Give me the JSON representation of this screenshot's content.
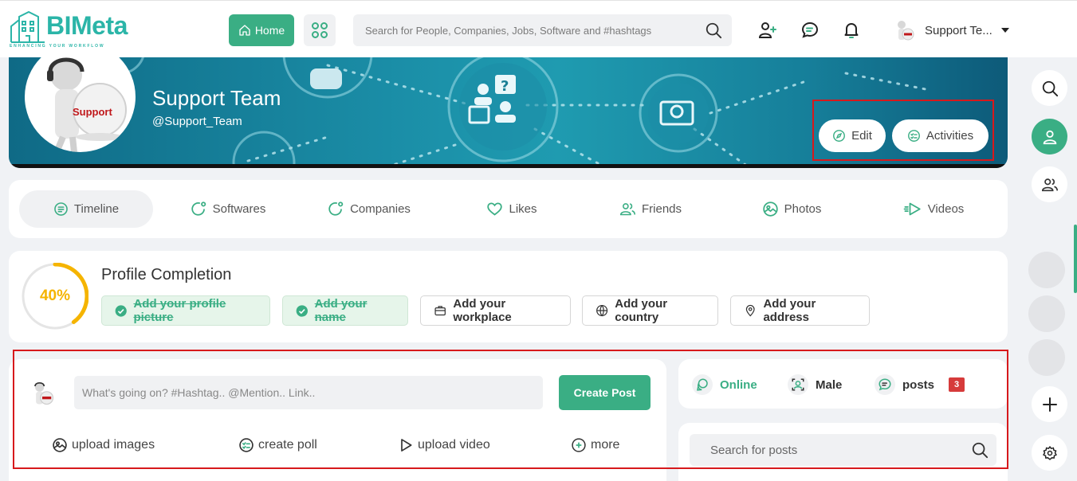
{
  "header": {
    "logo_text": "BIMeta",
    "logo_tagline": "ENHANCING YOUR WORKFLOW",
    "home_label": "Home",
    "search_placeholder": "Search for People, Companies, Jobs, Software and #hashtags",
    "user_name": "Support Te..."
  },
  "profile": {
    "name": "Support Team",
    "handle": "@Support_Team",
    "avatar_text": "Support",
    "edit_label": "Edit",
    "activities_label": "Activities"
  },
  "tabs": [
    {
      "label": "Timeline",
      "icon": "timeline-icon",
      "active": true
    },
    {
      "label": "Softwares",
      "icon": "softwares-icon"
    },
    {
      "label": "Companies",
      "icon": "companies-icon"
    },
    {
      "label": "Likes",
      "icon": "heart-icon"
    },
    {
      "label": "Friends",
      "icon": "friends-icon"
    },
    {
      "label": "Photos",
      "icon": "photos-icon"
    },
    {
      "label": "Videos",
      "icon": "videos-icon"
    }
  ],
  "completion": {
    "title": "Profile Completion",
    "percent_label": "40%",
    "percent": 40,
    "items": [
      {
        "label": "Add your profile picture",
        "done": true
      },
      {
        "label": "Add your name",
        "done": true
      },
      {
        "label": "Add your workplace",
        "icon": "briefcase-icon"
      },
      {
        "label": "Add your country",
        "icon": "globe-icon"
      },
      {
        "label": "Add your address",
        "icon": "location-pin-icon"
      }
    ]
  },
  "composer": {
    "placeholder": "What's going on? #Hashtag.. @Mention.. Link..",
    "create_label": "Create Post",
    "actions": [
      {
        "label": "upload images",
        "icon": "image-icon"
      },
      {
        "label": "create poll",
        "icon": "poll-icon"
      },
      {
        "label": "upload video",
        "icon": "play-icon"
      },
      {
        "label": "more",
        "icon": "plus-circle-icon"
      }
    ]
  },
  "stats": {
    "online_label": "Online",
    "gender_label": "Male",
    "posts_label": "posts",
    "posts_count": "3"
  },
  "post_search": {
    "placeholder": "Search for posts"
  },
  "colors": {
    "accent": "#3aae84",
    "logo": "#2bb5a8",
    "progress": "#f5b400",
    "badge": "#d63b3b",
    "highlight": "#d7191c"
  }
}
